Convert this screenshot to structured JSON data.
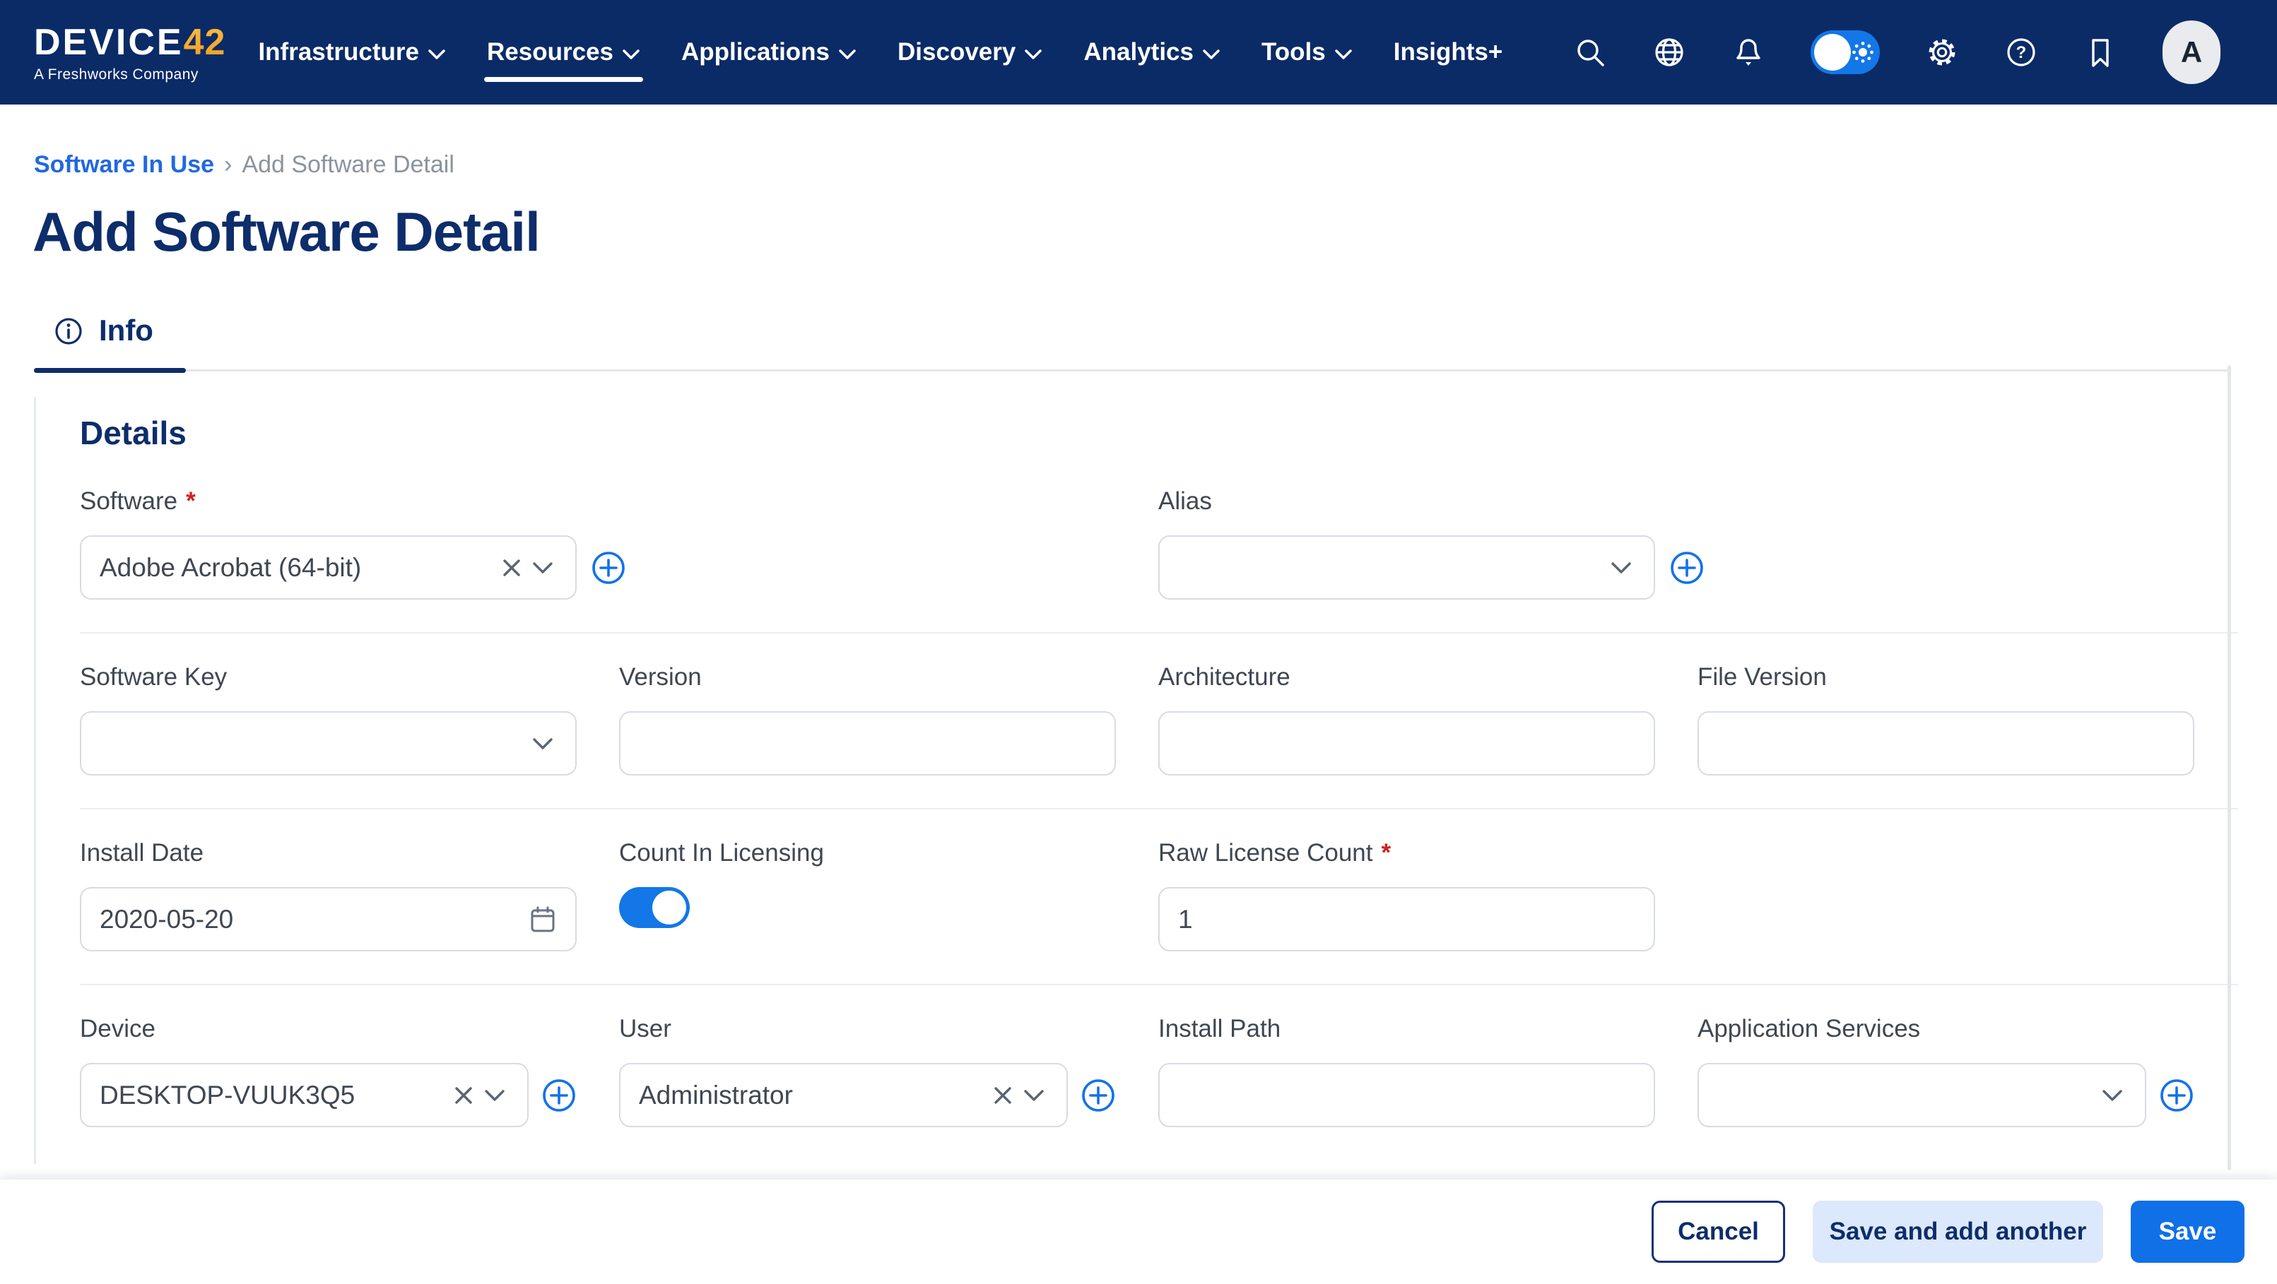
{
  "ui": {
    "required_marker": "*",
    "breadcrumb_separator": "›"
  },
  "colors": {
    "nav_bg": "#0B2B67",
    "navy": "#0D2D6B",
    "accent_blue": "#1372E8",
    "toggle_on": "#1377E8",
    "required_red": "#D21F1F",
    "brand_accent_orange": "#F5A623"
  },
  "nav": {
    "brand": {
      "name": "DEVICE",
      "accent": "42",
      "tagline": "A Freshworks Company"
    },
    "menu": [
      {
        "label": "Infrastructure",
        "chevron": true,
        "active": false
      },
      {
        "label": "Resources",
        "chevron": true,
        "active": true
      },
      {
        "label": "Applications",
        "chevron": true,
        "active": false
      },
      {
        "label": "Discovery",
        "chevron": true,
        "active": false
      },
      {
        "label": "Analytics",
        "chevron": true,
        "active": false
      },
      {
        "label": "Tools",
        "chevron": true,
        "active": false
      },
      {
        "label": "Insights+",
        "chevron": false,
        "active": false
      }
    ],
    "action_icons": [
      "search",
      "globe",
      "notifications",
      "theme-toggle",
      "settings",
      "help",
      "bookmark"
    ],
    "theme_toggle": {
      "state": "light",
      "knob_side": "left"
    },
    "avatar_initial": "A"
  },
  "breadcrumb": {
    "parent": "Software In Use",
    "current": "Add Software Detail"
  },
  "page": {
    "title": "Add Software Detail"
  },
  "tabs": [
    {
      "label": "Info",
      "icon": "info",
      "active": true
    }
  ],
  "details": {
    "heading": "Details",
    "fields": {
      "software": {
        "label": "Software",
        "required": true,
        "value": "Adobe Acrobat (64-bit)"
      },
      "alias": {
        "label": "Alias",
        "value": ""
      },
      "software_key": {
        "label": "Software Key",
        "value": ""
      },
      "version": {
        "label": "Version",
        "value": ""
      },
      "architecture": {
        "label": "Architecture",
        "value": ""
      },
      "file_version": {
        "label": "File Version",
        "value": ""
      },
      "install_date": {
        "label": "Install Date",
        "value": "2020-05-20"
      },
      "count_in_licensing": {
        "label": "Count In Licensing",
        "enabled": true
      },
      "raw_license_count": {
        "label": "Raw License Count",
        "required": true,
        "value": "1"
      },
      "device": {
        "label": "Device",
        "value": "DESKTOP-VUUK3Q5"
      },
      "user": {
        "label": "User",
        "value": "Administrator"
      },
      "install_path": {
        "label": "Install Path",
        "value": ""
      },
      "application_services": {
        "label": "Application Services",
        "value": ""
      }
    }
  },
  "footer": {
    "cancel_label": "Cancel",
    "save_add_label": "Save and add another",
    "save_label": "Save"
  }
}
